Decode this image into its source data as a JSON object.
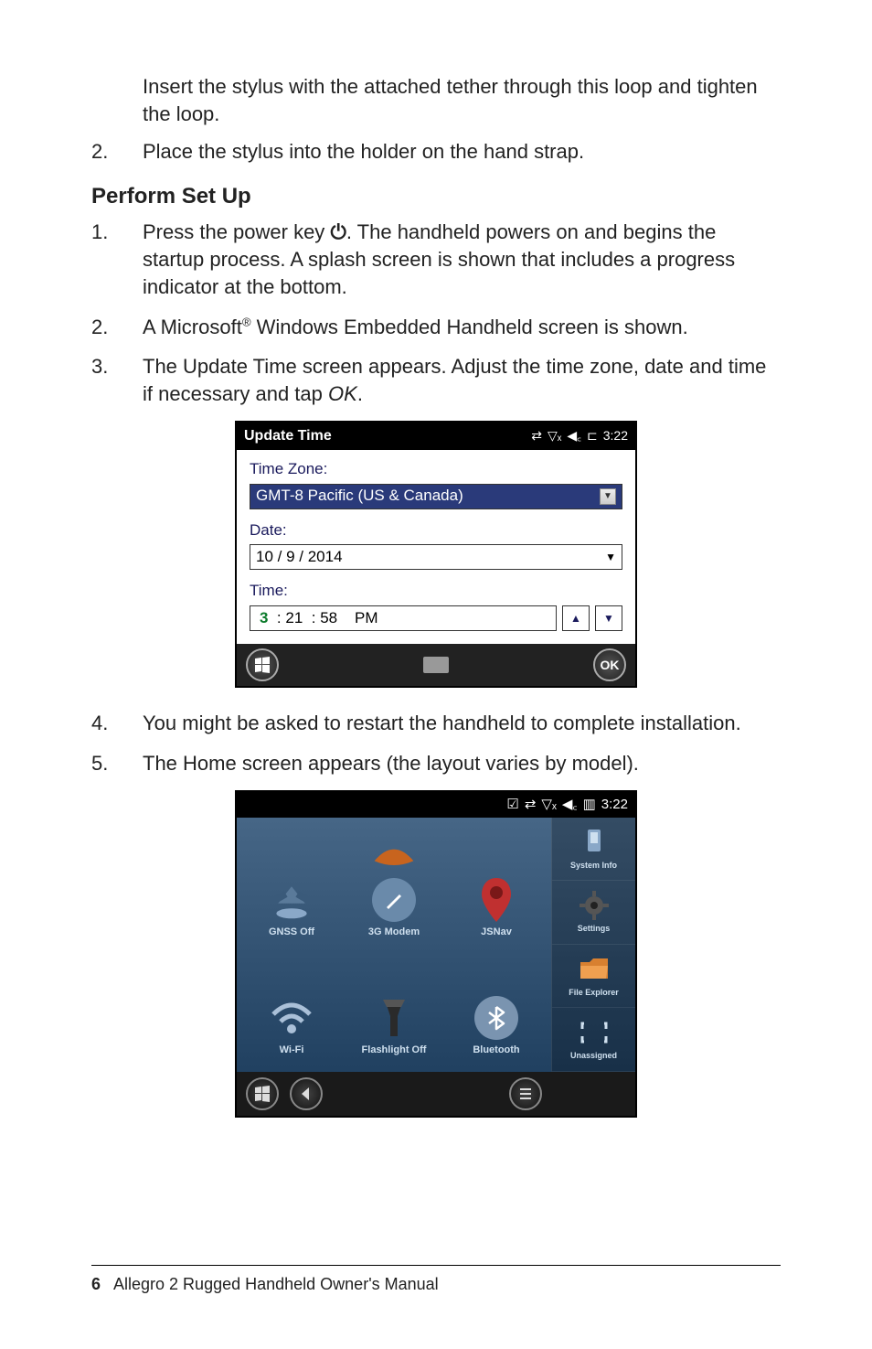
{
  "intro": {
    "cont_para": "Insert the stylus with the attached tether through this loop and tighten the loop.",
    "item2_num": "2.",
    "item2_text": "Place the stylus into the holder on the hand strap."
  },
  "heading": "Perform Set Up",
  "setup": {
    "i1_num": "1.",
    "i1_a": "Press the power key ",
    "i1_b": ". The handheld powers on and begins the startup process. A splash screen is shown that includes a progress indicator at the bottom.",
    "i2_num": "2.",
    "i2_a": "A Microsoft",
    "i2_sup": "®",
    "i2_b": " Windows Embedded Handheld screen is shown.",
    "i3_num": "3.",
    "i3_a": "The Update Time screen appears. Adjust the time zone, date and time if necessary and tap ",
    "i3_ok": "OK",
    "i3_b": ".",
    "i4_num": "4.",
    "i4_text": "You might be asked to restart the handheld to complete installation.",
    "i5_num": "5.",
    "i5_text": "The Home screen appears (the layout varies by model)."
  },
  "ss1": {
    "title": "Update Time",
    "clock": "3:22",
    "tz_label": "Time Zone:",
    "tz_value": "GMT-8 Pacific (US & Canada)",
    "date_label": "Date:",
    "date_value": "10  /   9   / 2014",
    "time_label": "Time:",
    "time_h": "3",
    "time_m": "21",
    "time_s": "58",
    "time_ampm": "PM",
    "ok": "OK"
  },
  "ss2": {
    "clock": "3:22",
    "cells": {
      "gnss": "GNSS Off",
      "modem": "3G Modem",
      "jsnav": "JSNav",
      "wifi": "Wi-Fi",
      "flash": "Flashlight Off",
      "bt": "Bluetooth"
    },
    "side": {
      "sysinfo": "System Info",
      "settings": "Settings",
      "explorer": "File Explorer",
      "unassigned": "Unassigned"
    }
  },
  "footer": {
    "page": "6",
    "title": "Allegro 2 Rugged Handheld Owner's Manual"
  }
}
